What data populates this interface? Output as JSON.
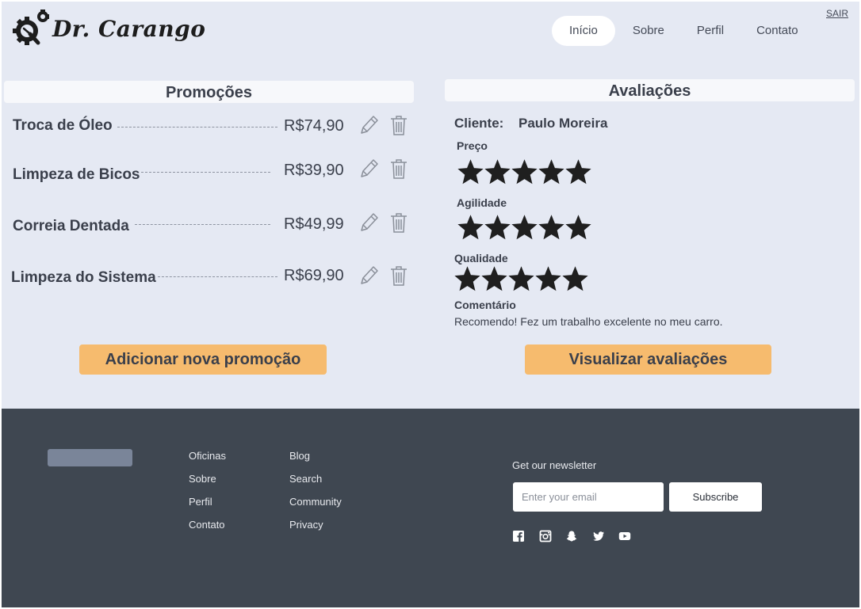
{
  "brand": {
    "name": "Dr. Carango",
    "logo_icon": "gear-magnifier-icon"
  },
  "nav": {
    "items": [
      {
        "label": "Início",
        "active": true
      },
      {
        "label": "Sobre",
        "active": false
      },
      {
        "label": "Perfil",
        "active": false
      },
      {
        "label": "Contato",
        "active": false
      }
    ],
    "logout_label": "SAIR"
  },
  "promotions": {
    "title": "Promoções",
    "items": [
      {
        "name": "Troca de Óleo",
        "price": "R$74,90"
      },
      {
        "name": "Limpeza de Bicos",
        "price": "R$39,90"
      },
      {
        "name": "Correia Dentada",
        "price": "R$49,99"
      },
      {
        "name": "Limpeza do Sistema",
        "price": "R$69,90"
      }
    ],
    "edit_icon": "pencil-icon",
    "delete_icon": "trash-icon",
    "add_button_label": "Adicionar nova promoção"
  },
  "reviews": {
    "title": "Avaliações",
    "client_label": "Cliente:",
    "client_name": "Paulo Moreira",
    "criteria": [
      {
        "label": "Preço",
        "stars": 5,
        "max": 5
      },
      {
        "label": "Agilidade",
        "stars": 5,
        "max": 5
      },
      {
        "label": "Qualidade",
        "stars": 5,
        "max": 5
      }
    ],
    "comment_label": "Comentário",
    "comment": "Recomendo! Fez um trabalho excelente no meu carro.",
    "view_button_label": "Visualizar avaliações"
  },
  "footer": {
    "column_1": [
      "Oficinas",
      "Sobre",
      "Perfil",
      "Contato"
    ],
    "column_2": [
      "Blog",
      "Search",
      "Community",
      "Privacy"
    ],
    "newsletter_label": "Get our newsletter",
    "email_placeholder": "Enter your email",
    "email_value": "",
    "subscribe_label": "Subscribe",
    "social_icons": [
      "facebook-icon",
      "instagram-icon",
      "snapchat-icon",
      "twitter-icon",
      "youtube-icon"
    ]
  },
  "colors": {
    "page_background": "#e5e9f3",
    "button_accent": "#f6bb6e",
    "footer_background": "#3f4751",
    "star": "#1f1f1f"
  }
}
